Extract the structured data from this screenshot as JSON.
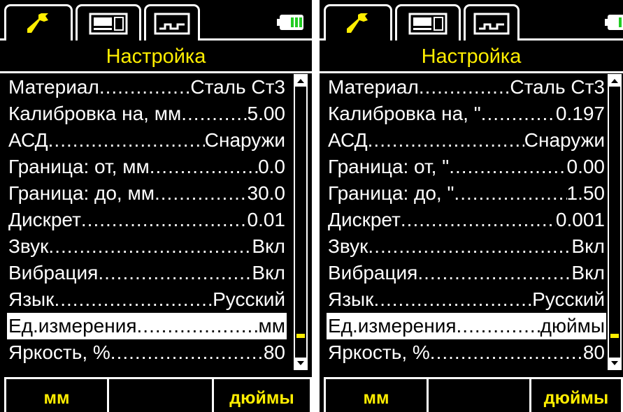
{
  "screens": [
    {
      "title": "Настройка",
      "tabs": [
        "wrench-icon",
        "numeric-display-icon",
        "chart-icon"
      ],
      "rows": [
        {
          "label": "Материал",
          "value": "Сталь Ст3",
          "selected": false
        },
        {
          "label": "Калибровка на, мм",
          "value": "5.00",
          "selected": false
        },
        {
          "label": "АСД",
          "value": "Снаружи",
          "selected": false
        },
        {
          "label": "Граница: от, мм",
          "value": "0.0",
          "selected": false
        },
        {
          "label": "Граница: до, мм",
          "value": "30.0",
          "selected": false
        },
        {
          "label": "Дискрет",
          "value": "0.01",
          "selected": false
        },
        {
          "label": "Звук",
          "value": "Вкл",
          "selected": false
        },
        {
          "label": "Вибрация",
          "value": "Вкл",
          "selected": false
        },
        {
          "label": "Язык",
          "value": "Русский",
          "selected": false
        },
        {
          "label": "Ед.измерения",
          "value": "мм",
          "selected": true
        },
        {
          "label": "Яркость, %",
          "value": "80",
          "selected": false
        }
      ],
      "softkeys": [
        "мм",
        "",
        "дюймы"
      ]
    },
    {
      "title": "Настройка",
      "tabs": [
        "wrench-icon",
        "numeric-display-icon",
        "chart-icon"
      ],
      "rows": [
        {
          "label": "Материал",
          "value": "Сталь Ст3",
          "selected": false
        },
        {
          "label": "Калибровка на, \"",
          "value": "0.197",
          "selected": false
        },
        {
          "label": "АСД",
          "value": "Снаружи",
          "selected": false
        },
        {
          "label": "Граница: от, \"",
          "value": "0.00",
          "selected": false
        },
        {
          "label": "Граница: до, \"",
          "value": "1.50",
          "selected": false
        },
        {
          "label": "Дискрет",
          "value": "0.001",
          "selected": false
        },
        {
          "label": "Звук",
          "value": "Вкл",
          "selected": false
        },
        {
          "label": "Вибрация",
          "value": "Вкл",
          "selected": false
        },
        {
          "label": "Язык",
          "value": "Русский",
          "selected": false
        },
        {
          "label": "Ед.измерения",
          "value": "дюймы",
          "selected": true
        },
        {
          "label": "Яркость, %",
          "value": "80",
          "selected": false
        }
      ],
      "softkeys": [
        "мм",
        "",
        "дюймы"
      ]
    }
  ],
  "colors": {
    "background": "#000000",
    "text": "#ffffff",
    "accent": "#ffee00",
    "battery": "#22cc22"
  }
}
